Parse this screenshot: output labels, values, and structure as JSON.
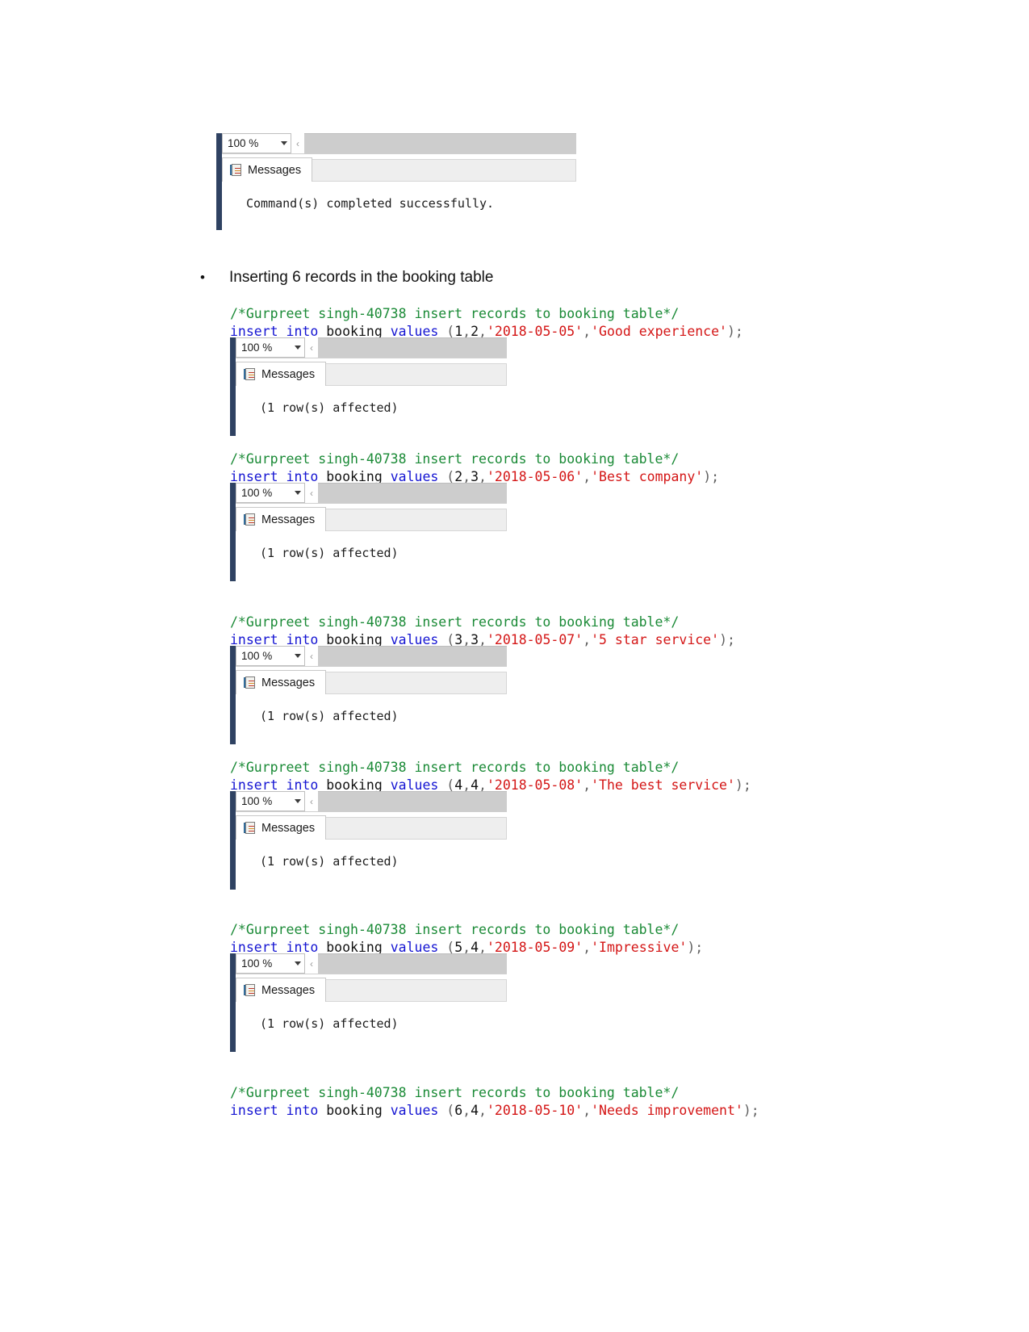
{
  "document": {
    "bullet": {
      "marker": "•",
      "text": "Inserting 6 records in the booking table"
    }
  },
  "panel_chrome": {
    "zoom_level": "100 %",
    "split_chevron": "‹",
    "tab_label": "Messages",
    "tab_icon": "messages-icon",
    "caret_icon": "chevron-down-icon"
  },
  "blocks": [
    {
      "id": "block-0",
      "has_code": false,
      "message": "Command(s) completed successfully."
    },
    {
      "id": "block-1",
      "has_code": true,
      "comment": "/*Gurpreet singh-40738 insert records to booking table*/",
      "code": {
        "kw1": "insert",
        "kw2": "into",
        "table": "booking",
        "kw3": "values",
        "open": " (",
        "num1": "1",
        "c1": ",",
        "num2": "2",
        "c2": ",",
        "date": "'2018-05-05'",
        "c3": ",",
        "text": "'Good experience'",
        "close": ");"
      },
      "message": "(1 row(s) affected)"
    },
    {
      "id": "block-2",
      "has_code": true,
      "comment": "/*Gurpreet singh-40738 insert records to booking table*/",
      "code": {
        "kw1": "insert",
        "kw2": "into",
        "table": "booking",
        "kw3": "values",
        "open": " (",
        "num1": "2",
        "c1": ",",
        "num2": "3",
        "c2": ",",
        "date": "'2018-05-06'",
        "c3": ",",
        "text": "'Best company'",
        "close": ");"
      },
      "message": "(1 row(s) affected)"
    },
    {
      "id": "block-3",
      "has_code": true,
      "comment": "/*Gurpreet singh-40738 insert records to booking table*/",
      "code": {
        "kw1": "insert",
        "kw2": "into",
        "table": "booking",
        "kw3": "values",
        "open": " (",
        "num1": "3",
        "c1": ",",
        "num2": "3",
        "c2": ",",
        "date": "'2018-05-07'",
        "c3": ",",
        "text": "'5 star service'",
        "close": ");"
      },
      "message": "(1 row(s) affected)"
    },
    {
      "id": "block-4",
      "has_code": true,
      "comment": "/*Gurpreet singh-40738 insert records to booking table*/",
      "code": {
        "kw1": "insert",
        "kw2": "into",
        "table": "booking",
        "kw3": "values",
        "open": " (",
        "num1": "4",
        "c1": ",",
        "num2": "4",
        "c2": ",",
        "date": "'2018-05-08'",
        "c3": ",",
        "text": "'The best service'",
        "close": ");"
      },
      "message": "(1 row(s) affected)"
    },
    {
      "id": "block-5",
      "has_code": true,
      "comment": "/*Gurpreet singh-40738 insert records to booking table*/",
      "code": {
        "kw1": "insert",
        "kw2": "into",
        "table": "booking",
        "kw3": "values",
        "open": " (",
        "num1": "5",
        "c1": ",",
        "num2": "4",
        "c2": ",",
        "date": "'2018-05-09'",
        "c3": ",",
        "text": "'Impressive'",
        "close": ");"
      },
      "message": "(1 row(s) affected)"
    },
    {
      "id": "block-6",
      "has_code": true,
      "comment": "/*Gurpreet singh-40738 insert records to booking table*/",
      "code": {
        "kw1": "insert",
        "kw2": "into",
        "table": "booking",
        "kw3": "values",
        "open": " (",
        "num1": "6",
        "c1": ",",
        "num2": "4",
        "c2": ",",
        "date": "'2018-05-10'",
        "c3": ",",
        "text": "'Needs improvement'",
        "close": ");"
      },
      "message": null
    }
  ],
  "colors": {
    "comment_green": "#1a8a36",
    "keyword_blue": "#1414d2",
    "string_red": "#d41616",
    "panel_leftbar": "#2f4262",
    "scrollbar_gray": "#cdcdcd"
  }
}
